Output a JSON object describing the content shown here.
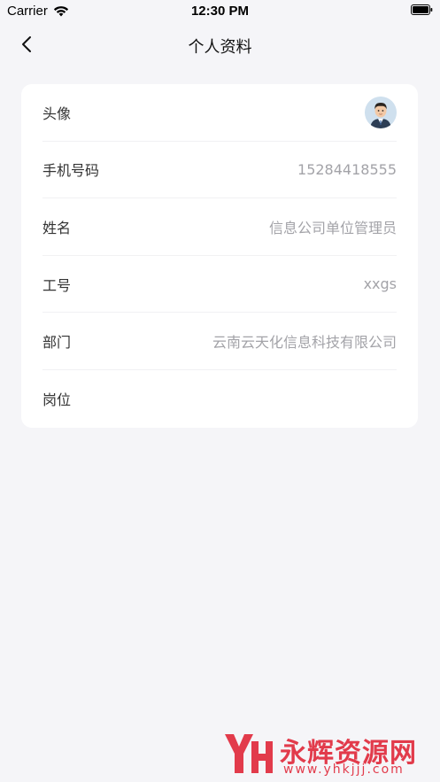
{
  "status_bar": {
    "carrier": "Carrier",
    "time": "12:30 PM"
  },
  "nav": {
    "title": "个人资料"
  },
  "profile": {
    "rows": [
      {
        "label": "头像",
        "value": ""
      },
      {
        "label": "手机号码",
        "value": "15284418555"
      },
      {
        "label": "姓名",
        "value": "信息公司单位管理员"
      },
      {
        "label": "工号",
        "value": "xxgs"
      },
      {
        "label": "部门",
        "value": "云南云天化信息科技有限公司"
      },
      {
        "label": "岗位",
        "value": ""
      }
    ]
  },
  "watermark": {
    "title": "永辉资源网",
    "url": "www.yhkjjj.com"
  },
  "colors": {
    "background": "#f5f5f8",
    "card": "#ffffff",
    "label": "#333333",
    "value": "#a3a3a8",
    "watermark": "#e23b4b"
  }
}
